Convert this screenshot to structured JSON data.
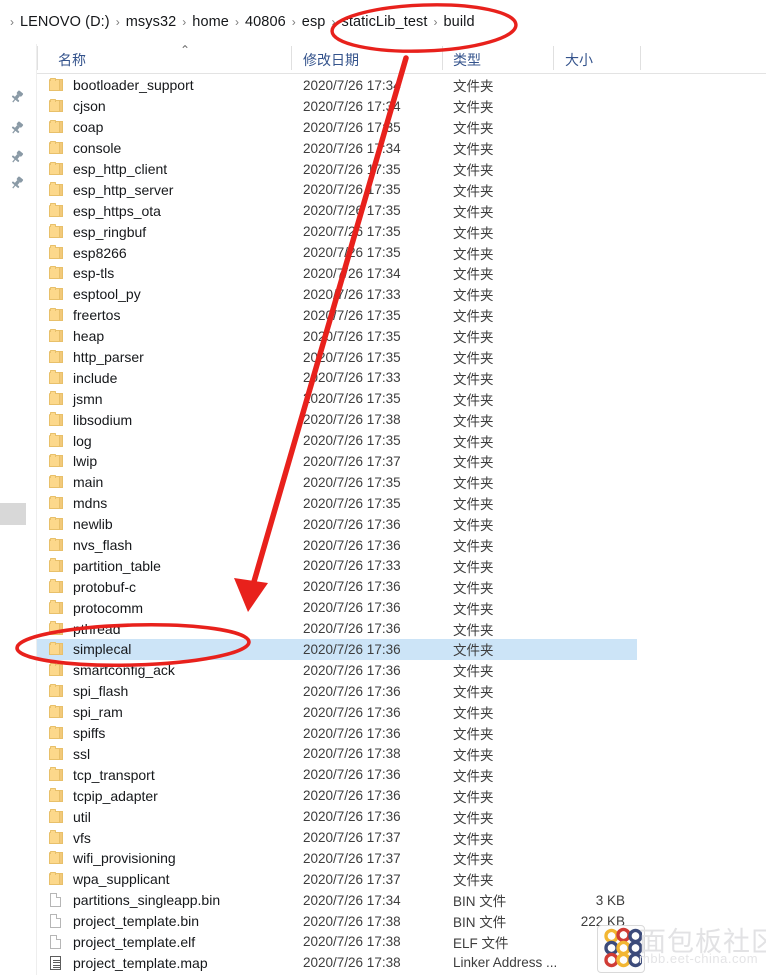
{
  "window": {
    "breadcrumb": {
      "separator": "›",
      "items": [
        "LENOVO (D:)",
        "msys32",
        "home",
        "40806",
        "esp",
        "staticLib_test",
        "build"
      ]
    },
    "columns": {
      "name": "名称",
      "date_modified": "修改日期",
      "type": "类型",
      "size": "大小",
      "sort_indicator": "⌃"
    }
  },
  "nav_pane": {
    "pin_icon": "pin-icon",
    "pin_count": 4
  },
  "files": [
    {
      "name": "bootloader_support",
      "date": "2020/7/26 17:34",
      "type": "文件夹",
      "size": "",
      "icon": "folder",
      "selected": false
    },
    {
      "name": "cjson",
      "date": "2020/7/26 17:34",
      "type": "文件夹",
      "size": "",
      "icon": "folder",
      "selected": false
    },
    {
      "name": "coap",
      "date": "2020/7/26 17:35",
      "type": "文件夹",
      "size": "",
      "icon": "folder",
      "selected": false
    },
    {
      "name": "console",
      "date": "2020/7/26 17:34",
      "type": "文件夹",
      "size": "",
      "icon": "folder",
      "selected": false
    },
    {
      "name": "esp_http_client",
      "date": "2020/7/26 17:35",
      "type": "文件夹",
      "size": "",
      "icon": "folder",
      "selected": false
    },
    {
      "name": "esp_http_server",
      "date": "2020/7/26 17:35",
      "type": "文件夹",
      "size": "",
      "icon": "folder",
      "selected": false
    },
    {
      "name": "esp_https_ota",
      "date": "2020/7/26 17:35",
      "type": "文件夹",
      "size": "",
      "icon": "folder",
      "selected": false
    },
    {
      "name": "esp_ringbuf",
      "date": "2020/7/26 17:35",
      "type": "文件夹",
      "size": "",
      "icon": "folder",
      "selected": false
    },
    {
      "name": "esp8266",
      "date": "2020/7/26 17:35",
      "type": "文件夹",
      "size": "",
      "icon": "folder",
      "selected": false
    },
    {
      "name": "esp-tls",
      "date": "2020/7/26 17:34",
      "type": "文件夹",
      "size": "",
      "icon": "folder",
      "selected": false
    },
    {
      "name": "esptool_py",
      "date": "2020/7/26 17:33",
      "type": "文件夹",
      "size": "",
      "icon": "folder",
      "selected": false
    },
    {
      "name": "freertos",
      "date": "2020/7/26 17:35",
      "type": "文件夹",
      "size": "",
      "icon": "folder",
      "selected": false
    },
    {
      "name": "heap",
      "date": "2020/7/26 17:35",
      "type": "文件夹",
      "size": "",
      "icon": "folder",
      "selected": false
    },
    {
      "name": "http_parser",
      "date": "2020/7/26 17:35",
      "type": "文件夹",
      "size": "",
      "icon": "folder",
      "selected": false
    },
    {
      "name": "include",
      "date": "2020/7/26 17:33",
      "type": "文件夹",
      "size": "",
      "icon": "folder",
      "selected": false
    },
    {
      "name": "jsmn",
      "date": "2020/7/26 17:35",
      "type": "文件夹",
      "size": "",
      "icon": "folder",
      "selected": false
    },
    {
      "name": "libsodium",
      "date": "2020/7/26 17:38",
      "type": "文件夹",
      "size": "",
      "icon": "folder",
      "selected": false
    },
    {
      "name": "log",
      "date": "2020/7/26 17:35",
      "type": "文件夹",
      "size": "",
      "icon": "folder",
      "selected": false
    },
    {
      "name": "lwip",
      "date": "2020/7/26 17:37",
      "type": "文件夹",
      "size": "",
      "icon": "folder",
      "selected": false
    },
    {
      "name": "main",
      "date": "2020/7/26 17:35",
      "type": "文件夹",
      "size": "",
      "icon": "folder",
      "selected": false
    },
    {
      "name": "mdns",
      "date": "2020/7/26 17:35",
      "type": "文件夹",
      "size": "",
      "icon": "folder",
      "selected": false
    },
    {
      "name": "newlib",
      "date": "2020/7/26 17:36",
      "type": "文件夹",
      "size": "",
      "icon": "folder",
      "selected": false
    },
    {
      "name": "nvs_flash",
      "date": "2020/7/26 17:36",
      "type": "文件夹",
      "size": "",
      "icon": "folder",
      "selected": false
    },
    {
      "name": "partition_table",
      "date": "2020/7/26 17:33",
      "type": "文件夹",
      "size": "",
      "icon": "folder",
      "selected": false
    },
    {
      "name": "protobuf-c",
      "date": "2020/7/26 17:36",
      "type": "文件夹",
      "size": "",
      "icon": "folder",
      "selected": false
    },
    {
      "name": "protocomm",
      "date": "2020/7/26 17:36",
      "type": "文件夹",
      "size": "",
      "icon": "folder",
      "selected": false
    },
    {
      "name": "pthread",
      "date": "2020/7/26 17:36",
      "type": "文件夹",
      "size": "",
      "icon": "folder",
      "selected": false
    },
    {
      "name": "simplecal",
      "date": "2020/7/26 17:36",
      "type": "文件夹",
      "size": "",
      "icon": "folder",
      "selected": true
    },
    {
      "name": "smartconfig_ack",
      "date": "2020/7/26 17:36",
      "type": "文件夹",
      "size": "",
      "icon": "folder",
      "selected": false
    },
    {
      "name": "spi_flash",
      "date": "2020/7/26 17:36",
      "type": "文件夹",
      "size": "",
      "icon": "folder",
      "selected": false
    },
    {
      "name": "spi_ram",
      "date": "2020/7/26 17:36",
      "type": "文件夹",
      "size": "",
      "icon": "folder",
      "selected": false
    },
    {
      "name": "spiffs",
      "date": "2020/7/26 17:36",
      "type": "文件夹",
      "size": "",
      "icon": "folder",
      "selected": false
    },
    {
      "name": "ssl",
      "date": "2020/7/26 17:38",
      "type": "文件夹",
      "size": "",
      "icon": "folder",
      "selected": false
    },
    {
      "name": "tcp_transport",
      "date": "2020/7/26 17:36",
      "type": "文件夹",
      "size": "",
      "icon": "folder",
      "selected": false
    },
    {
      "name": "tcpip_adapter",
      "date": "2020/7/26 17:36",
      "type": "文件夹",
      "size": "",
      "icon": "folder",
      "selected": false
    },
    {
      "name": "util",
      "date": "2020/7/26 17:36",
      "type": "文件夹",
      "size": "",
      "icon": "folder",
      "selected": false
    },
    {
      "name": "vfs",
      "date": "2020/7/26 17:37",
      "type": "文件夹",
      "size": "",
      "icon": "folder",
      "selected": false
    },
    {
      "name": "wifi_provisioning",
      "date": "2020/7/26 17:37",
      "type": "文件夹",
      "size": "",
      "icon": "folder",
      "selected": false
    },
    {
      "name": "wpa_supplicant",
      "date": "2020/7/26 17:37",
      "type": "文件夹",
      "size": "",
      "icon": "folder",
      "selected": false
    },
    {
      "name": "partitions_singleapp.bin",
      "date": "2020/7/26 17:34",
      "type": "BIN 文件",
      "size": "3 KB",
      "icon": "file",
      "selected": false
    },
    {
      "name": "project_template.bin",
      "date": "2020/7/26 17:38",
      "type": "BIN 文件",
      "size": "222 KB",
      "icon": "file",
      "selected": false
    },
    {
      "name": "project_template.elf",
      "date": "2020/7/26 17:38",
      "type": "ELF 文件",
      "size": "",
      "icon": "file",
      "selected": false
    },
    {
      "name": "project_template.map",
      "date": "2020/7/26 17:38",
      "type": "Linker Address ...",
      "size": "",
      "icon": "document",
      "selected": false
    }
  ],
  "annotations": {
    "color": "#e8211c",
    "ellipse_breadcrumb_label": "staticLib_test › build",
    "ellipse_row_label": "simplecal",
    "arrow_label": "points-from-breadcrumb-to-simplecal-row"
  },
  "watermark": {
    "text": "面包板社区",
    "url": "mbb.eet-china.com"
  }
}
